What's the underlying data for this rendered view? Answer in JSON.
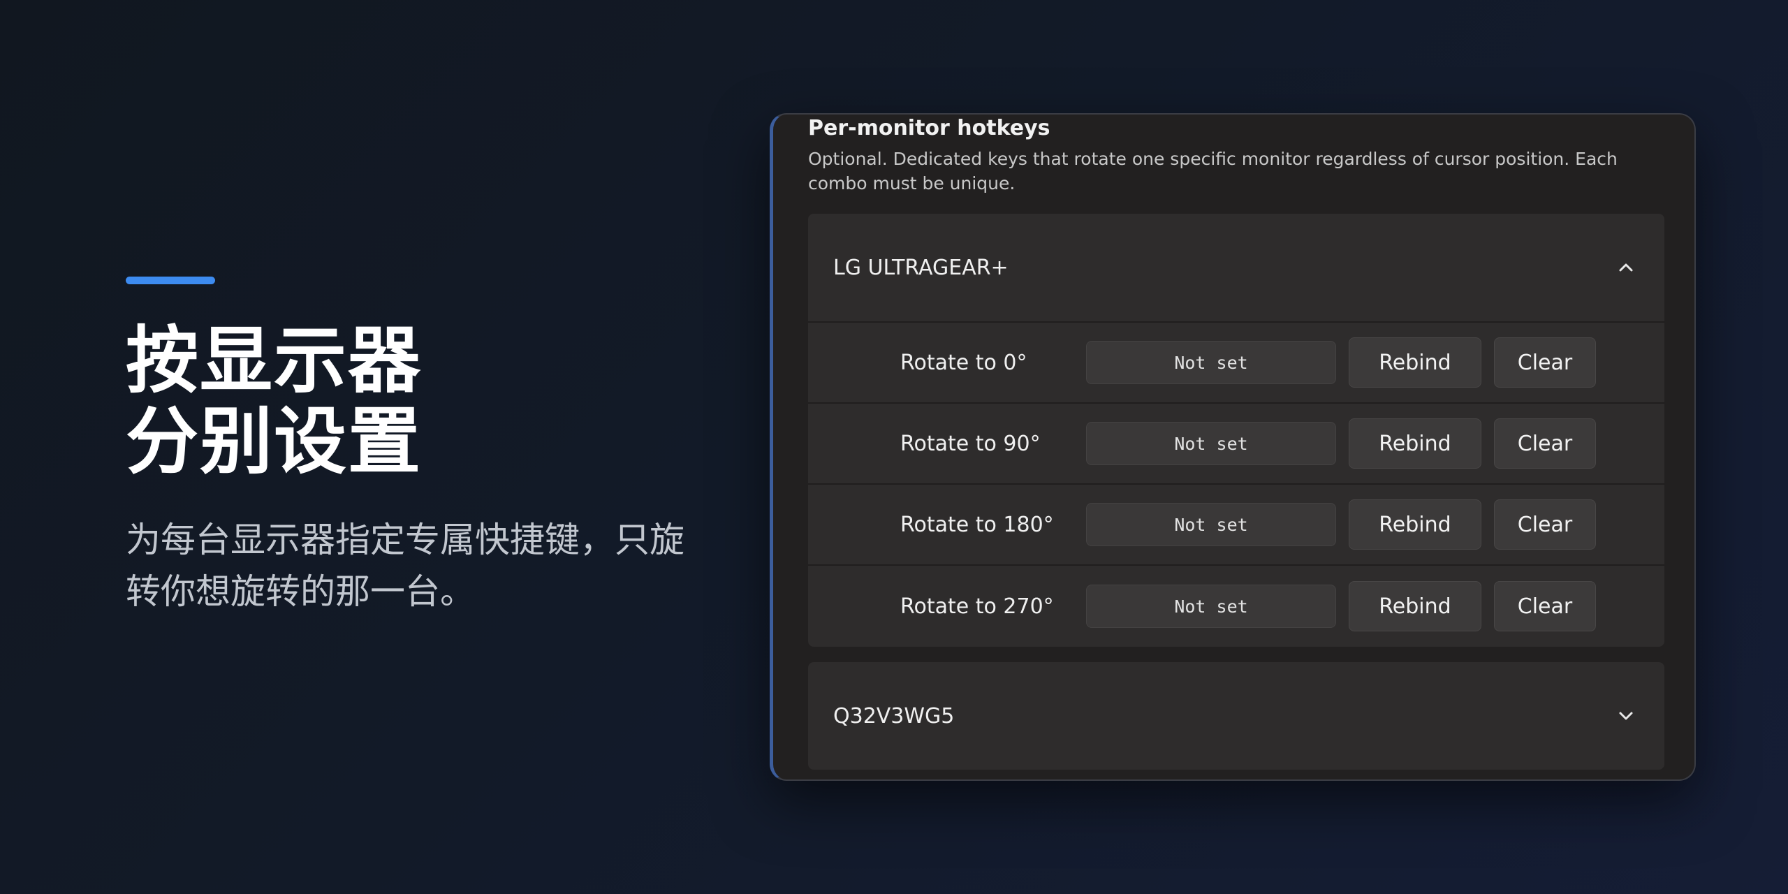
{
  "promo": {
    "headline_line1": "按显示器",
    "headline_line2": "分别设置",
    "subtext": "为每台显示器指定专属快捷键，只旋转你想旋转的那一台。",
    "accent_color": "#3d8bf0"
  },
  "settings": {
    "section_title": "Per-monitor hotkeys",
    "section_description": "Optional. Dedicated keys that rotate one specific monitor regardless of cursor position. Each combo must be unique.",
    "monitors": [
      {
        "name": "LG ULTRAGEAR+",
        "expanded": true,
        "chevron_icon": "chevron-up-icon",
        "rows": [
          {
            "label": "Rotate to 0°",
            "hotkey": "Not set",
            "rebind_label": "Rebind",
            "clear_label": "Clear"
          },
          {
            "label": "Rotate to 90°",
            "hotkey": "Not set",
            "rebind_label": "Rebind",
            "clear_label": "Clear"
          },
          {
            "label": "Rotate to 180°",
            "hotkey": "Not set",
            "rebind_label": "Rebind",
            "clear_label": "Clear"
          },
          {
            "label": "Rotate to 270°",
            "hotkey": "Not set",
            "rebind_label": "Rebind",
            "clear_label": "Clear"
          }
        ]
      },
      {
        "name": "Q32V3WG5",
        "expanded": false,
        "chevron_icon": "chevron-down-icon"
      }
    ]
  }
}
